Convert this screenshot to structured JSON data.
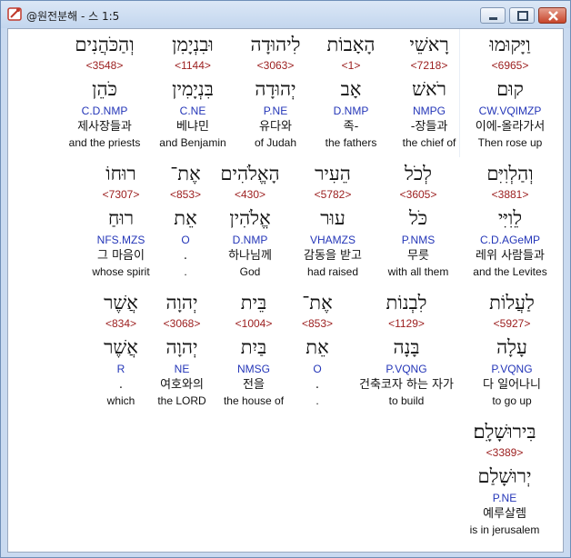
{
  "window": {
    "title": "@원전분해 - 스 1:5"
  },
  "verse": {
    "rows": [
      {
        "words": [
          {
            "hebrew": "וַיָּקוּמוּ",
            "strong": "<6965>",
            "lemma": "קוּם",
            "morph": "CW.VQIMZP",
            "korean": "이에-올라가서",
            "english": "Then rose up"
          },
          {
            "hebrew": "רָאשֵׁי",
            "strong": "<7218>",
            "lemma": "רֹאשׁ",
            "morph": "NMPG",
            "korean": "-장들과",
            "english": "the chief of"
          },
          {
            "hebrew": "הָאָבוֹת",
            "strong": "<1>",
            "lemma": "אָב",
            "morph": "D.NMP",
            "korean": "족-",
            "english": "the fathers"
          },
          {
            "hebrew": "לִיהוּדָה",
            "strong": "<3063>",
            "lemma": "יְהוּדָה",
            "morph": "P.NE",
            "korean": "유다와",
            "english": "of Judah"
          },
          {
            "hebrew": "וּבִנְיָמִן",
            "strong": "<1144>",
            "lemma": "בִּנְיָמִין",
            "morph": "C.NE",
            "korean": "베냐민",
            "english": "and Benjamin"
          },
          {
            "hebrew": "וְהַכֹּהֲנִים",
            "strong": "<3548>",
            "lemma": "כֹּהֵן",
            "morph": "C.D.NMP",
            "korean": "제사장들과",
            "english": "and the priests"
          }
        ]
      },
      {
        "words": [
          {
            "hebrew": "וְהַלְוִיִּם",
            "strong": "<3881>",
            "lemma": "לֵוִיִּי",
            "morph": "C.D.AGeMP",
            "korean": "레위 사람들과",
            "english": "and the Levites"
          },
          {
            "hebrew": "לְכֹל",
            "strong": "<3605>",
            "lemma": "כֹּל",
            "morph": "P.NMS",
            "korean": "무릇",
            "english": "with all them"
          },
          {
            "hebrew": "הֵעִיר",
            "strong": "<5782>",
            "lemma": "עוּר",
            "morph": "VHAMZS",
            "korean": "감동을 받고",
            "english": "had raised"
          },
          {
            "hebrew": "הָאֱלֹהִים",
            "strong": "<430>",
            "lemma": "אֱלֹהִין",
            "morph": "D.NMP",
            "korean": "하나님께",
            "english": "God"
          },
          {
            "hebrew": "אֶת־",
            "strong": "<853>",
            "lemma": "אֵת",
            "morph": "O",
            "korean": ".",
            "english": "."
          },
          {
            "hebrew": "רוּחוֹ",
            "strong": "<7307>",
            "lemma": "רוּחַ",
            "morph": "NFS.MZS",
            "korean": "그 마음이",
            "english": "whose spirit"
          }
        ]
      },
      {
        "words": [
          {
            "hebrew": "לַעֲלוֹת",
            "strong": "<5927>",
            "lemma": "עָלָה",
            "morph": "P.VQNG",
            "korean": "다 일어나니",
            "english": "to go up"
          },
          {
            "hebrew": "לִבְנוֹת",
            "strong": "<1129>",
            "lemma": "בָּנָה",
            "morph": "P.VQNG",
            "korean": "건축코자 하는 자가",
            "english": "to build"
          },
          {
            "hebrew": "אֶת־",
            "strong": "<853>",
            "lemma": "אֵת",
            "morph": "O",
            "korean": ".",
            "english": "."
          },
          {
            "hebrew": "בֵּית",
            "strong": "<1004>",
            "lemma": "בַּיִת",
            "morph": "NMSG",
            "korean": "전을",
            "english": "the house of"
          },
          {
            "hebrew": "יְהוָה",
            "strong": "<3068>",
            "lemma": "יְהוָה",
            "morph": "NE",
            "korean": "여호와의",
            "english": "the LORD"
          },
          {
            "hebrew": "אֲשֶׁר",
            "strong": "<834>",
            "lemma": "אֲשֶׁר",
            "morph": "R",
            "korean": ".",
            "english": "which"
          }
        ]
      },
      {
        "words": [
          {
            "hebrew": "בִּירוּשָׁלִָם׃",
            "strong": "<3389>",
            "lemma": "יְרוּשָׁלַם",
            "morph": "P.NE",
            "korean": "예루살렘",
            "english": "is in jerusalem"
          }
        ]
      }
    ]
  },
  "colors": {
    "strong": "#9b1d1d",
    "morph": "#2436b8",
    "text": "#111111"
  },
  "icons": {
    "app": "bible-app-icon",
    "minimize": "minimize-icon",
    "maximize": "maximize-icon",
    "close": "close-icon"
  }
}
